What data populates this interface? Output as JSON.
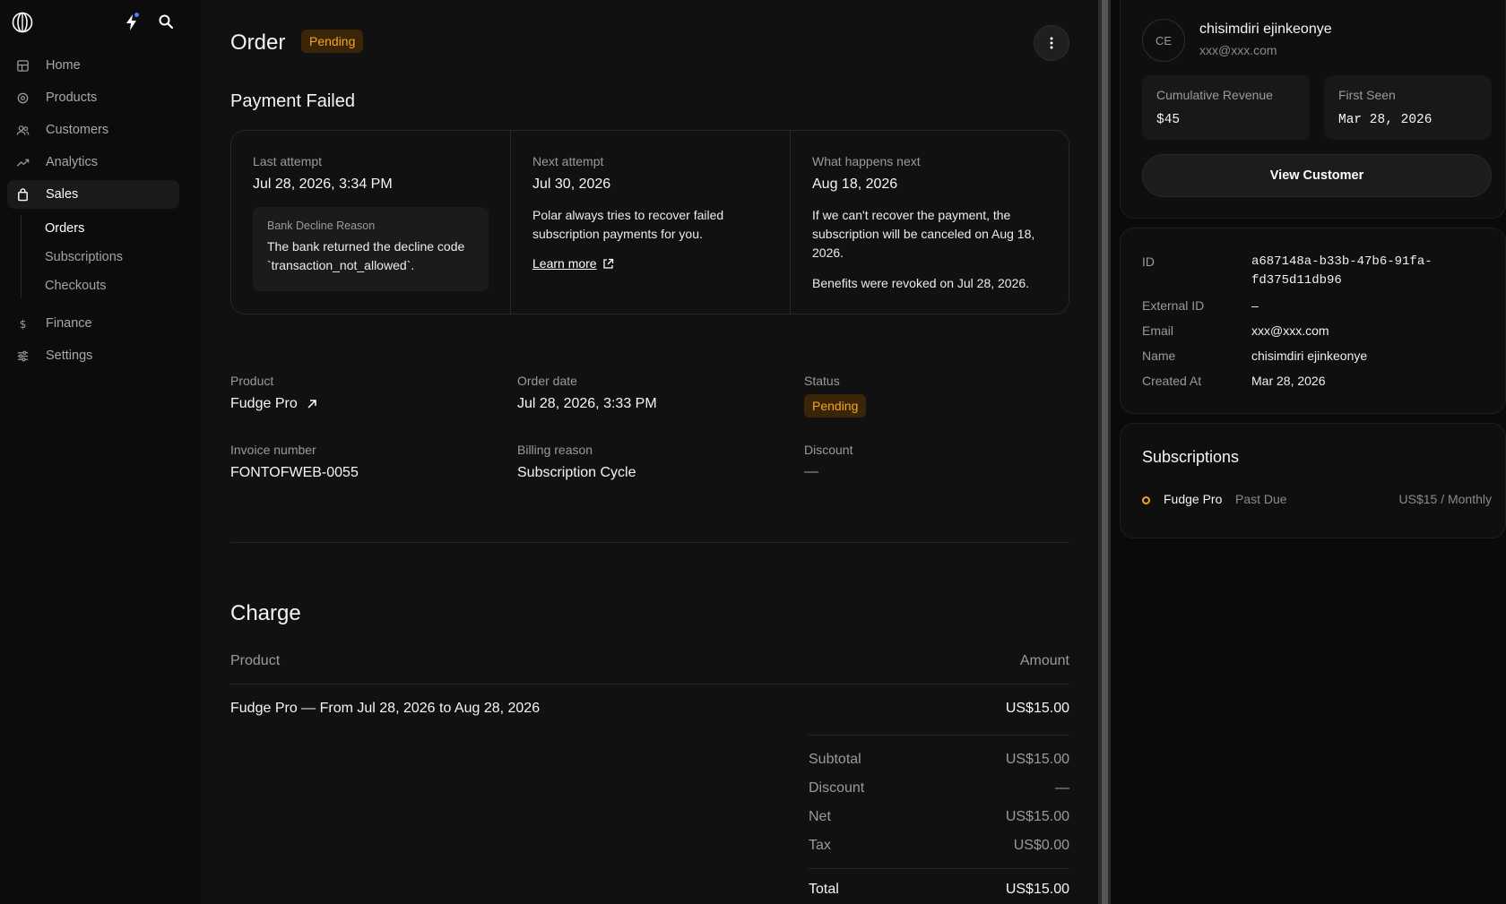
{
  "sidebar": {
    "nav": [
      {
        "label": "Home",
        "icon": "home-icon"
      },
      {
        "label": "Products",
        "icon": "products-icon"
      },
      {
        "label": "Customers",
        "icon": "customers-icon"
      },
      {
        "label": "Analytics",
        "icon": "analytics-icon"
      },
      {
        "label": "Sales",
        "icon": "sales-icon",
        "active": true
      },
      {
        "label": "Finance",
        "icon": "dollar-icon"
      },
      {
        "label": "Settings",
        "icon": "settings-icon"
      }
    ],
    "sales_sub": [
      "Orders",
      "Subscriptions",
      "Checkouts"
    ]
  },
  "order": {
    "title": "Order",
    "status_badge": "Pending",
    "payment_failed": {
      "heading": "Payment Failed",
      "last_attempt_label": "Last attempt",
      "last_attempt_value": "Jul 28, 2026, 3:34 PM",
      "decline_label": "Bank Decline Reason",
      "decline_text": "The bank returned the decline code `transaction_not_allowed`.",
      "next_attempt_label": "Next attempt",
      "next_attempt_value": "Jul 30, 2026",
      "next_attempt_text": "Polar always tries to recover failed subscription payments for you.",
      "learn_more": "Learn more",
      "next_label": "What happens next",
      "next_value": "Aug 18, 2026",
      "next_text": "If we can't recover the payment, the subscription will be canceled on Aug 18, 2026.",
      "benefits_text": "Benefits were revoked on Jul 28, 2026."
    },
    "details": {
      "product_label": "Product",
      "product_value": "Fudge Pro",
      "order_date_label": "Order date",
      "order_date_value": "Jul 28, 2026, 3:33 PM",
      "status_label": "Status",
      "status_value": "Pending",
      "invoice_label": "Invoice number",
      "invoice_value": "FONTOFWEB-0055",
      "billing_label": "Billing reason",
      "billing_value": "Subscription Cycle",
      "discount_label": "Discount",
      "discount_value": "—"
    },
    "charge": {
      "heading": "Charge",
      "col_product": "Product",
      "col_amount": "Amount",
      "line_item": "Fudge Pro — From Jul 28, 2026 to Aug 28, 2026",
      "line_amount": "US$15.00",
      "subtotal_label": "Subtotal",
      "subtotal_value": "US$15.00",
      "discount_label": "Discount",
      "discount_value": "—",
      "net_label": "Net",
      "net_value": "US$15.00",
      "tax_label": "Tax",
      "tax_value": "US$0.00",
      "total_label": "Total",
      "total_value": "US$15.00"
    }
  },
  "customer": {
    "initials": "CE",
    "name": "chisimdiri ejinkeonye",
    "email": "xxx@xxx.com",
    "revenue_label": "Cumulative Revenue",
    "revenue_value": "$45",
    "first_seen_label": "First Seen",
    "first_seen_value": "Mar 28, 2026",
    "view_button": "View Customer",
    "id_label": "ID",
    "id_value_line1": "a687148a-b33b-47b6-91fa-",
    "id_value_line2": "fd375d11db96",
    "external_id_label": "External ID",
    "external_id_value": "–",
    "email_label": "Email",
    "email_value": "xxx@xxx.com",
    "name_label": "Name",
    "name_value": "chisimdiri ejinkeonye",
    "created_label": "Created At",
    "created_value": "Mar 28, 2026",
    "subscriptions_heading": "Subscriptions",
    "subscription": {
      "name": "Fudge Pro",
      "status": "Past Due",
      "price": "US$15 / Monthly"
    }
  },
  "colors": {
    "accent_pending": "#f5a524",
    "badge_bg": "#3a2607",
    "notification_dot": "#4c7cff"
  }
}
